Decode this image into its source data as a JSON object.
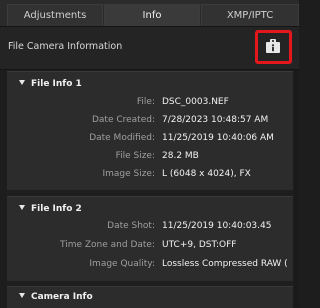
{
  "tabs": [
    {
      "label": "Adjustments"
    },
    {
      "label": "Info"
    },
    {
      "label": "XMP/IPTC"
    }
  ],
  "header": {
    "title": "File  Camera Information"
  },
  "sections": [
    {
      "title": "File Info 1",
      "rows": [
        {
          "label": "File:",
          "value": "DSC_0003.NEF"
        },
        {
          "label": "Date Created:",
          "value": "7/28/2023 10:48:57 AM"
        },
        {
          "label": "Date Modified:",
          "value": "11/25/2019 10:40:06 AM"
        },
        {
          "label": "File Size:",
          "value": "28.2 MB"
        },
        {
          "label": "Image Size:",
          "value": "L (6048 x 4024), FX"
        }
      ]
    },
    {
      "title": "File Info 2",
      "rows": [
        {
          "label": "Date Shot:",
          "value": "11/25/2019 10:40:03.45"
        },
        {
          "label": "Time Zone and Date:",
          "value": "UTC+9, DST:OFF"
        },
        {
          "label": "Image Quality:",
          "value": "Lossless Compressed RAW ("
        }
      ]
    },
    {
      "title": "Camera Info",
      "rows": []
    }
  ],
  "icons": {
    "info_button": "info-card-icon"
  },
  "colors": {
    "highlight": "#e5171d"
  }
}
